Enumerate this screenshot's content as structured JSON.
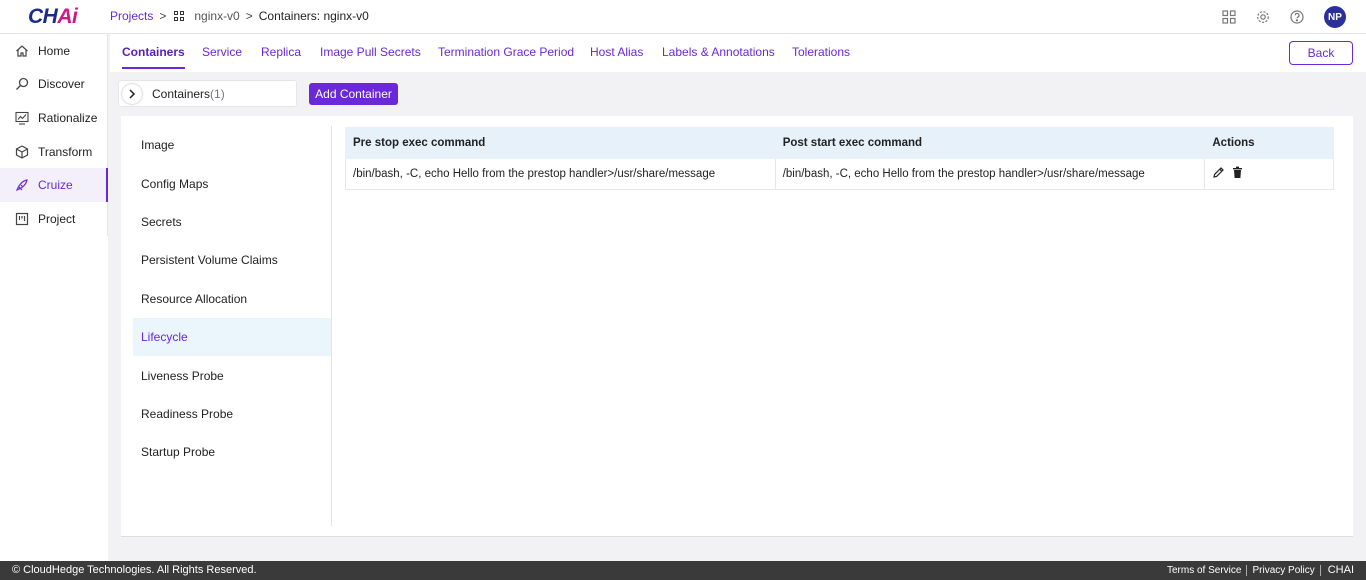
{
  "header": {
    "logo_main": "CH",
    "logo_accent": "Ai",
    "breadcrumbs": {
      "projects": "Projects",
      "project": "nginx-v0",
      "current": "Containers: nginx-v0"
    },
    "avatar_initials": "NP"
  },
  "sidebar": {
    "items": [
      {
        "label": "Home",
        "icon": "home-icon"
      },
      {
        "label": "Discover",
        "icon": "discover-icon"
      },
      {
        "label": "Rationalize",
        "icon": "rationalize-icon"
      },
      {
        "label": "Transform",
        "icon": "transform-icon"
      },
      {
        "label": "Cruize",
        "icon": "cruize-icon"
      },
      {
        "label": "Project",
        "icon": "project-icon"
      }
    ],
    "active": "Cruize"
  },
  "tabs": {
    "items": [
      "Containers",
      "Service",
      "Replica",
      "Image Pull Secrets",
      "Termination Grace Period",
      "Host Alias",
      "Labels & Annotations",
      "Tolerations"
    ],
    "active": "Containers",
    "back_label": "Back"
  },
  "containers": {
    "label": "Containers",
    "count": "(1)",
    "add_label": "Add Container"
  },
  "left_menu": {
    "items": [
      "Image",
      "Config Maps",
      "Secrets",
      "Persistent Volume Claims",
      "Resource Allocation",
      "Lifecycle",
      "Liveness Probe",
      "Readiness Probe",
      "Startup Probe"
    ],
    "active": "Lifecycle"
  },
  "lifecycle_table": {
    "columns": [
      "Pre stop exec command",
      "Post start exec command",
      "Actions"
    ],
    "rows": [
      {
        "pre_stop": "/bin/bash, -C, echo Hello from the prestop handler>/usr/share/message",
        "post_start": "/bin/bash, -C, echo Hello from the prestop handler>/usr/share/message"
      }
    ]
  },
  "footer": {
    "copyright": "© CloudHedge Technologies. All Rights Reserved.",
    "links": [
      "Terms of Service",
      "Privacy Policy"
    ],
    "brand": "CHAI"
  },
  "colors": {
    "accent": "#6a28d9",
    "header_row": "#e6f1fa",
    "active_menu": "#eaf6fb",
    "footer": "#3a3a3a"
  }
}
